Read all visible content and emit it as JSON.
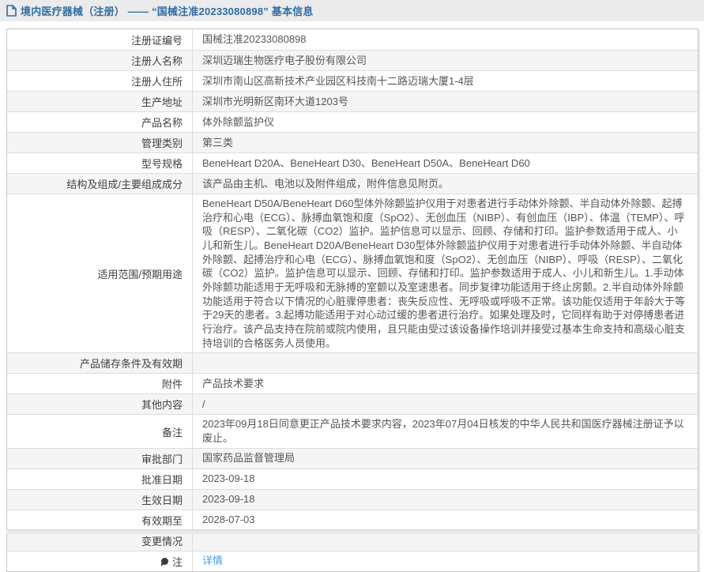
{
  "header": {
    "icon": "document-icon",
    "title": "境内医疗器械（注册）  ——  “国械注准20233080898”  基本信息",
    "bar_color": "#ebebeb",
    "text_color": "#2e6da4"
  },
  "colors": {
    "row_alt": "#f5f5f5",
    "border": "#c6c6c6",
    "inner_border": "#dddddd",
    "label_text": "#404040",
    "value_text": "#565656",
    "link_blue": "#4a9eea"
  },
  "table": {
    "rows": [
      {
        "label": "注册证编号",
        "value": "国械注准20233080898",
        "value_type": "text"
      },
      {
        "label": "注册人名称",
        "value": "深圳迈瑞生物医疗电子股份有限公司",
        "value_type": "text"
      },
      {
        "label": "注册人住所",
        "value": "深圳市南山区高新技术产业园区科技南十二路迈瑞大厦1-4层",
        "value_type": "text"
      },
      {
        "label": "生产地址",
        "value": "深圳市光明新区南环大道1203号",
        "value_type": "text"
      },
      {
        "label": "产品名称",
        "value": "体外除颤监护仪",
        "value_type": "text"
      },
      {
        "label": "管理类别",
        "value": "第三类",
        "value_type": "text"
      },
      {
        "label": "型号规格",
        "value": "BeneHeart D20A、BeneHeart D30、BeneHeart D50A、BeneHeart D60",
        "value_type": "text"
      },
      {
        "label": "结构及组成/主要组成成分",
        "value": "该产品由主机、电池以及附件组成，附件信息见附页。",
        "value_type": "text"
      },
      {
        "label": "适用范围/预期用途",
        "value": "BeneHeart D50A/BeneHeart D60型体外除颤监护仪用于对患者进行手动体外除颤、半自动体外除颤、起搏治疗和心电（ECG）、脉搏血氧饱和度（SpO2）、无创血压（NIBP）、有创血压（IBP）、体温（TEMP）、呼吸（RESP）、二氧化碳（CO2）监护。监护信息可以显示、回顾、存储和打印。监护参数适用于成人、小儿和新生儿。BeneHeart D20A/BeneHeart D30型体外除颤监护仪用于对患者进行手动体外除颤、半自动体外除颤、起搏治疗和心电（ECG）、脉搏血氧饱和度（SpO2）、无创血压（NIBP）、呼吸（RESP）、二氧化碳（CO2）监护。监护信息可以显示、回顾、存储和打印。监护参数适用于成人、小儿和新生儿。1.手动体外除颤功能适用于无呼吸和无脉搏的室颤以及室速患者。同步复律功能适用于终止房颤。2.半自动体外除颤功能适用于符合以下情况的心脏骤停患者：丧失反应性、无呼吸或呼吸不正常。该功能仅适用于年龄大于等于29天的患者。3.起搏功能适用于对心动过缓的患者进行治疗。如果处理及时，它同样有助于对停搏患者进行治疗。该产品支持在院前或院内使用，且只能由受过该设备操作培训并接受过基本生命支持和高级心脏支持培训的合格医务人员使用。",
        "value_type": "text"
      },
      {
        "label": "产品储存条件及有效期",
        "value": "",
        "value_type": "empty"
      },
      {
        "label": "附件",
        "value": "产品技术要求",
        "value_type": "text"
      },
      {
        "label": "其他内容",
        "value": "/",
        "value_type": "text"
      },
      {
        "label": "备注",
        "value": "2023年09月18日同意更正产品技术要求内容，2023年07月04日核发的中华人民共和国医疗器械注册证予以废止。",
        "value_type": "text"
      },
      {
        "label": "审批部门",
        "value": "国家药品监督管理局",
        "value_type": "text"
      },
      {
        "label": "批准日期",
        "value": "2023-09-18",
        "value_type": "text"
      },
      {
        "label": "生效日期",
        "value": "2023-09-18",
        "value_type": "text"
      },
      {
        "label": "有效期至",
        "value": "2028-07-03",
        "value_type": "text"
      },
      {
        "label": "变更情况",
        "value": "",
        "value_type": "empty"
      },
      {
        "label": "注",
        "label_icon": "note-pin-icon",
        "value": "详情",
        "value_type": "link"
      }
    ]
  }
}
